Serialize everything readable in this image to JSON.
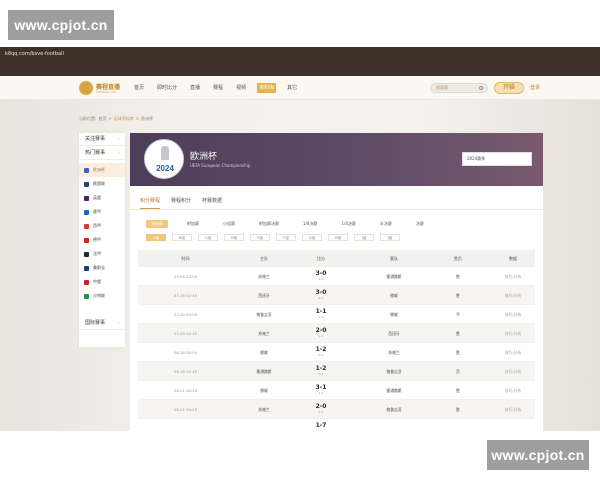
{
  "watermark": {
    "top": "www.cpjot.cn",
    "bottom": "www.cpjot.cn"
  },
  "browser": {
    "url": "k8qq.com/bsve-football"
  },
  "nav": {
    "logo": "赛程直播",
    "logo_sub": "KAIFANG TIYU",
    "items": [
      "首页",
      "即时比分",
      "直播",
      "赛程",
      "视频",
      "资料库",
      "其它"
    ],
    "active_index": 5,
    "search_placeholder": "搜索赛",
    "kaichang": "开猫",
    "login": "登录"
  },
  "breadcrumb": {
    "prefix": "当前位置:",
    "home": "首页",
    "sep1": ">",
    "section": "足球资料库",
    "sep2": ">",
    "current": "欧洲杯"
  },
  "sidebar": {
    "sections": [
      {
        "label": "关注赛事",
        "arrow": "›"
      },
      {
        "label": "热门赛事",
        "arrow": "›"
      },
      {
        "label": "国际赛事",
        "arrow": "›"
      }
    ],
    "items": [
      {
        "label": "欧洲杯",
        "color": "#3d63b8"
      },
      {
        "label": "欧国联",
        "color": "#2a3f7a"
      },
      {
        "label": "英超",
        "color": "#4b1d6b"
      },
      {
        "label": "意甲",
        "color": "#1b67c5"
      },
      {
        "label": "西甲",
        "color": "#d73a2f"
      },
      {
        "label": "德甲",
        "color": "#d1231e"
      },
      {
        "label": "法甲",
        "color": "#1c2a3a"
      },
      {
        "label": "美职业",
        "color": "#1e3c6e"
      },
      {
        "label": "中超",
        "color": "#c6242b"
      },
      {
        "label": "沙特联",
        "color": "#2c8e4e"
      }
    ]
  },
  "banner": {
    "title": "欧洲杯",
    "subtitle": "UEFA European Championship",
    "logo_text": "2024",
    "season": "2024赛季"
  },
  "tabs": [
    "积分赛程",
    "赛程积分",
    "杯赛数据"
  ],
  "stages": [
    "预选赛",
    "附加赛",
    "小组赛",
    "附加赛决赛",
    "1/8决赛",
    "1/4决赛",
    "半决赛",
    "决赛"
  ],
  "rounds": [
    "A组",
    "B组",
    "C组",
    "D组",
    "E组",
    "F组",
    "G组",
    "H组",
    "I组",
    "J组"
  ],
  "table": {
    "headers": [
      "时间",
      "主队",
      "比分",
      "客队",
      "胜负",
      "数据"
    ],
    "rows": [
      {
        "time": "03-05 22:00",
        "home": "苏格兰",
        "score": "3-0",
        "half": "1-0",
        "away": "塞浦路斯",
        "result": "胜",
        "data": "技巧/分析"
      },
      {
        "time": "03-26 02:45",
        "home": "西班牙",
        "score": "3-0",
        "half": "2-0",
        "away": "挪威",
        "result": "胜",
        "data": "技巧/分析"
      },
      {
        "time": "03-29 00:00",
        "home": "格鲁吉亚",
        "score": "1-1",
        "half": "1-0",
        "away": "挪威",
        "result": "平",
        "data": "技巧/分析"
      },
      {
        "time": "03-29 02:45",
        "home": "苏格兰",
        "score": "2-0",
        "half": "1-0",
        "away": "西班牙",
        "result": "胜",
        "data": "技巧/分析"
      },
      {
        "time": "06-18 00:00",
        "home": "挪威",
        "score": "1-2",
        "half": "0-1",
        "away": "苏格兰",
        "result": "胜",
        "data": "技巧/分析"
      },
      {
        "time": "06-18 02:45",
        "home": "塞浦路斯",
        "score": "1-2",
        "half": "0-1",
        "away": "格鲁吉亚",
        "result": "负",
        "data": "技巧/分析"
      },
      {
        "time": "06-21 02:45",
        "home": "挪威",
        "score": "3-1",
        "half": "1-0",
        "away": "塞浦路斯",
        "result": "胜",
        "data": "技巧/分析"
      },
      {
        "time": "06-21 04:25",
        "home": "苏格兰",
        "score": "2-0",
        "half": "1-0",
        "away": "格鲁吉亚",
        "result": "胜",
        "data": "技巧/分析"
      },
      {
        "time": "",
        "home": "",
        "score": "1-7",
        "half": "",
        "away": "",
        "result": "",
        "data": ""
      }
    ]
  }
}
